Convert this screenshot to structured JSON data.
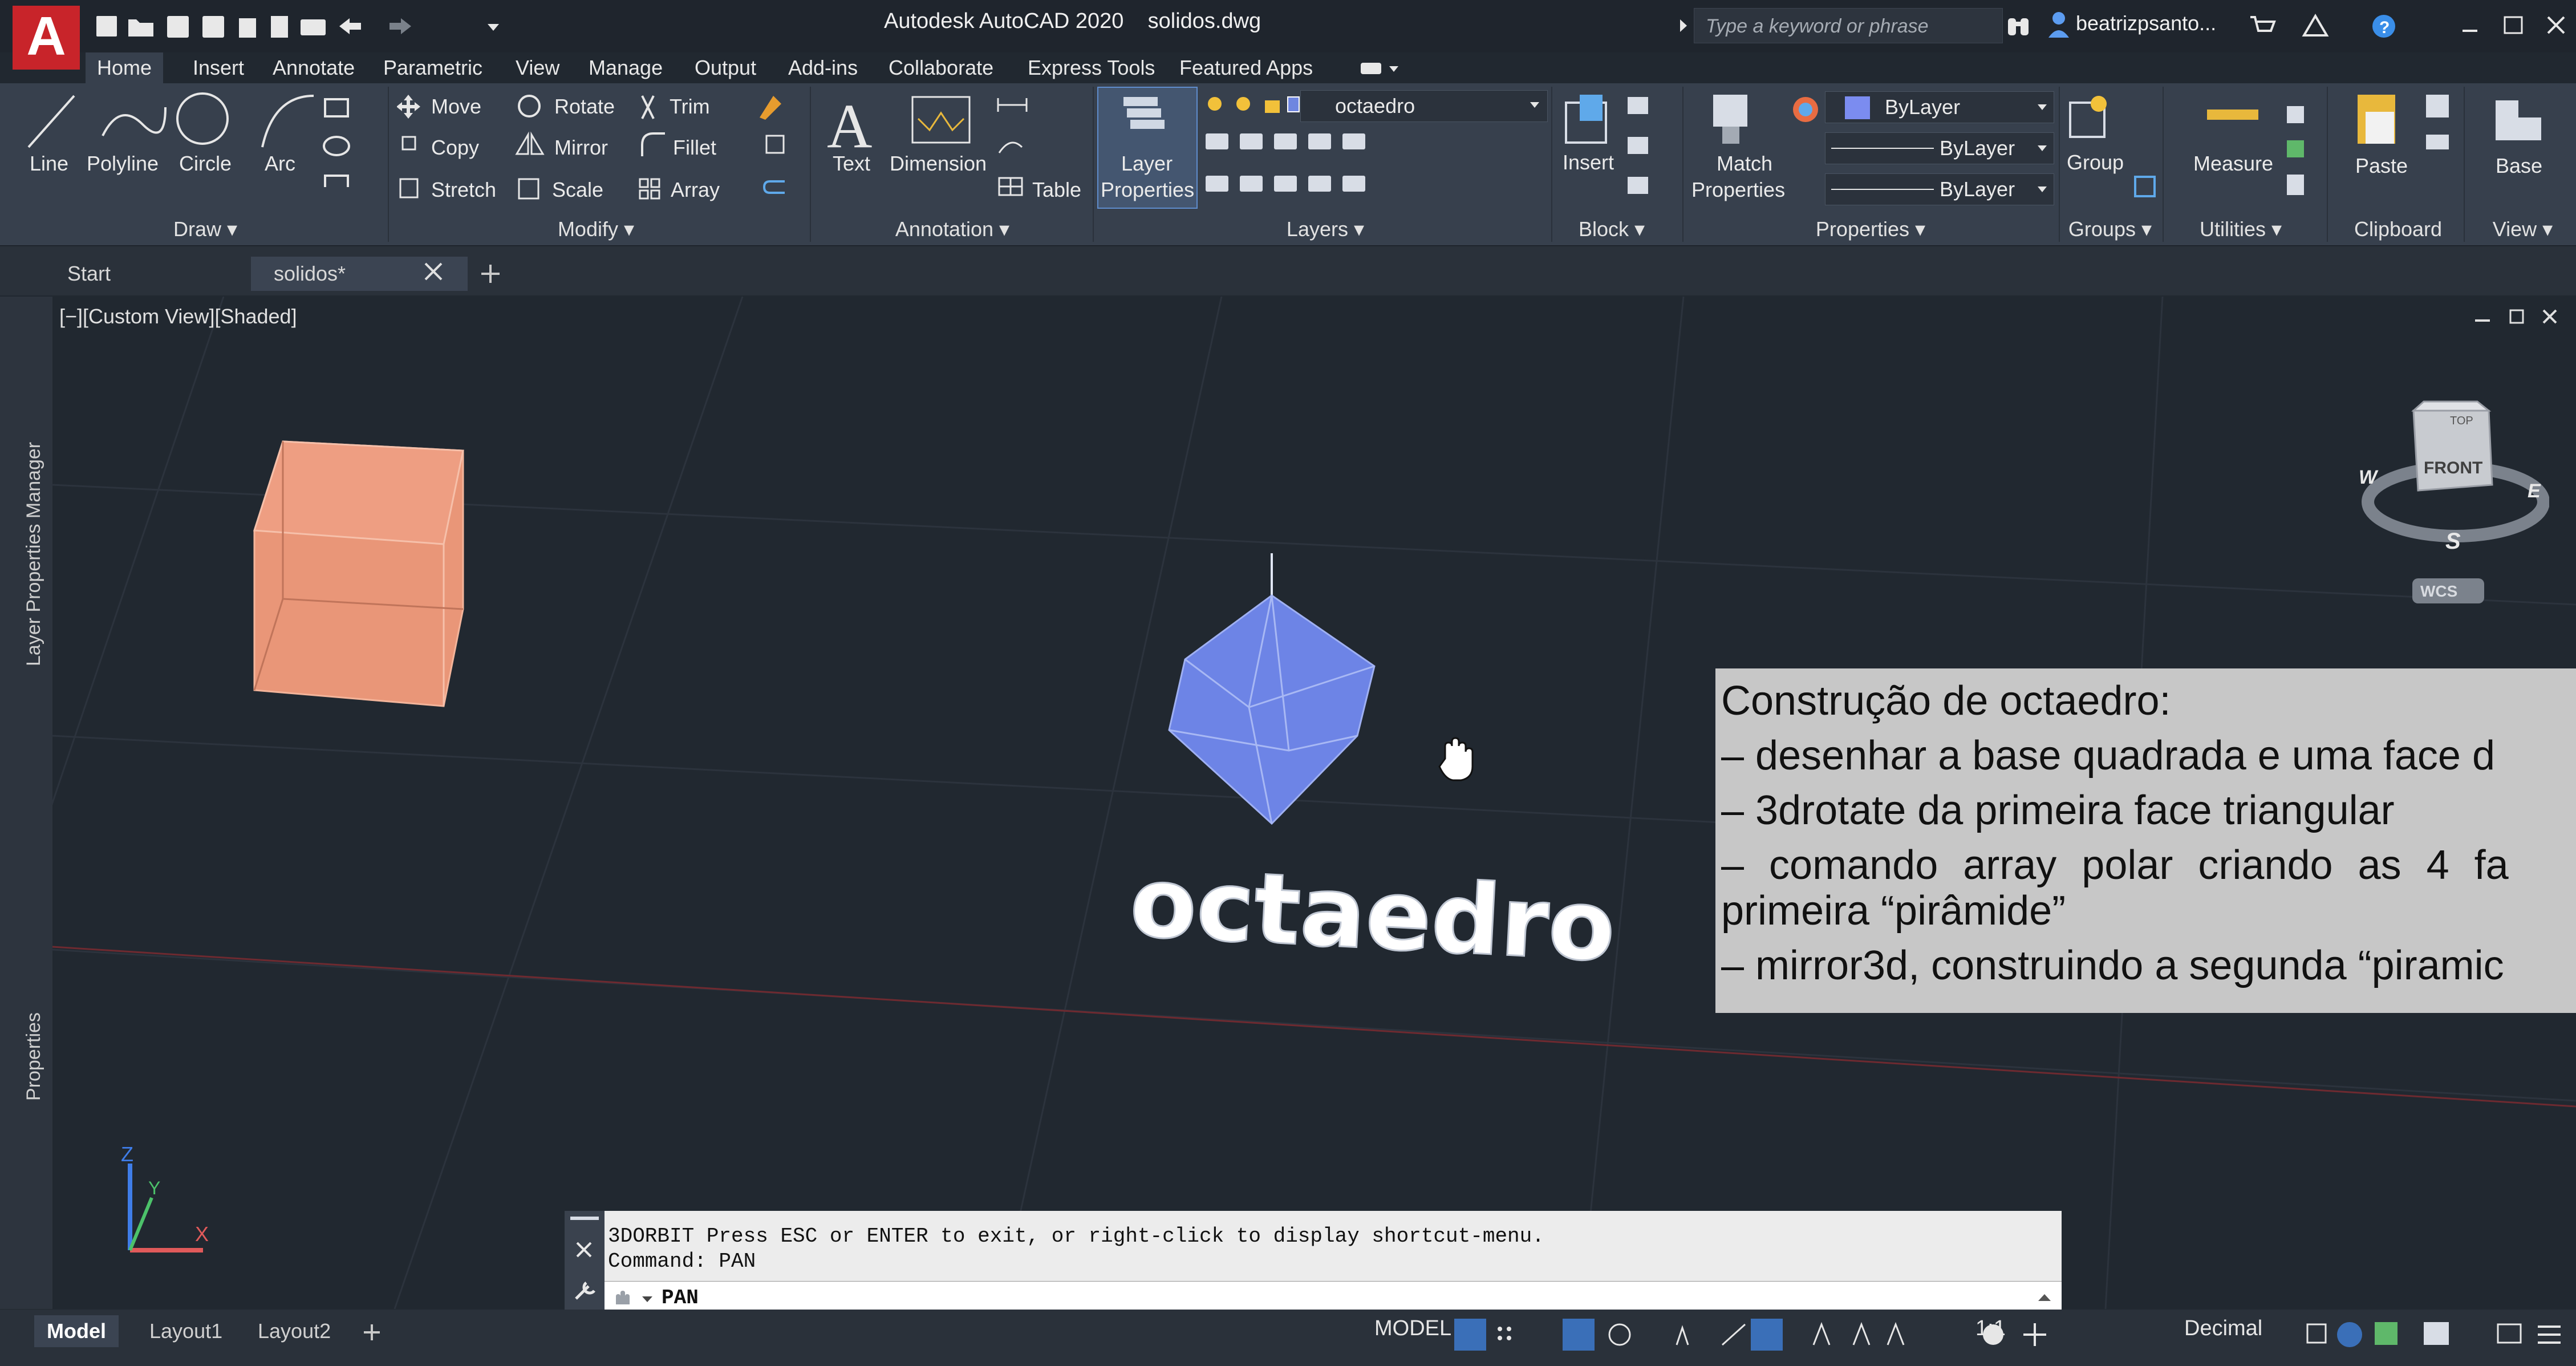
{
  "app": {
    "logo": "A",
    "title": "Autodesk AutoCAD 2020",
    "filename": "solidos.dwg",
    "search_placeholder": "Type a keyword or phrase",
    "user": "beatrizpsanto..."
  },
  "ribbon_tabs": [
    "Home",
    "Insert",
    "Annotate",
    "Parametric",
    "View",
    "Manage",
    "Output",
    "Add-ins",
    "Collaborate",
    "Express Tools",
    "Featured Apps"
  ],
  "ribbon": {
    "draw": {
      "label": "Draw",
      "line": "Line",
      "polyline": "Polyline",
      "circle": "Circle",
      "arc": "Arc"
    },
    "modify": {
      "label": "Modify",
      "move": "Move",
      "rotate": "Rotate",
      "trim": "Trim",
      "copy": "Copy",
      "mirror": "Mirror",
      "fillet": "Fillet",
      "stretch": "Stretch",
      "scale": "Scale",
      "array": "Array"
    },
    "annotation": {
      "label": "Annotation",
      "text": "Text",
      "dimension": "Dimension",
      "table": "Table"
    },
    "layers": {
      "label": "Layers",
      "layer_properties_1": "Layer",
      "layer_properties_2": "Properties",
      "current_layer": "octaedro",
      "layer_color": "#6f86e0"
    },
    "block": {
      "label": "Block",
      "insert": "Insert"
    },
    "properties": {
      "label": "Properties",
      "match_1": "Match",
      "match_2": "Properties",
      "color": "ByLayer",
      "linetype": "ByLayer",
      "lineweight": "ByLayer",
      "color_swatch": "#7b8cf0"
    },
    "groups": {
      "label": "Groups",
      "group": "Group"
    },
    "utilities": {
      "label": "Utilities",
      "measure": "Measure"
    },
    "clipboard": {
      "label": "Clipboard",
      "paste": "Paste"
    },
    "view": {
      "label": "View",
      "base": "Base"
    }
  },
  "doc_tabs": {
    "start": "Start",
    "current": "solidos*"
  },
  "viewport": {
    "label": "[−][Custom View][Shaded]",
    "palette_layer": "Layer Properties Manager",
    "palette_props": "Properties",
    "octahedron_text": "octaedro",
    "cube_color": "#e99678",
    "octa_color": "#6d84e6",
    "viewcube": {
      "top": "TOP",
      "front": "FRONT",
      "w": "W",
      "e": "E",
      "s": "S",
      "wcs": "WCS"
    },
    "ucs": {
      "z": "Z",
      "y": "Y",
      "x": "X"
    }
  },
  "note": {
    "line1": "Construção de octaedro:",
    "line2": "– desenhar a base quadrada e uma face d",
    "line3": "– 3drotate da primeira face triangular",
    "line4": "– comando array polar criando as 4 fa",
    "line5": "primeira “pirâmide”",
    "line6": "– mirror3d, construindo a segunda “piramic"
  },
  "command": {
    "history1": "3DORBIT Press ESC or ENTER to exit, or right-click to display shortcut-menu.",
    "history2": "Command: PAN",
    "input": "PAN"
  },
  "status": {
    "model_tab": "Model",
    "layout1": "Layout1",
    "layout2": "Layout2",
    "mode": "MODEL",
    "scale": "1:1",
    "units": "Decimal"
  }
}
